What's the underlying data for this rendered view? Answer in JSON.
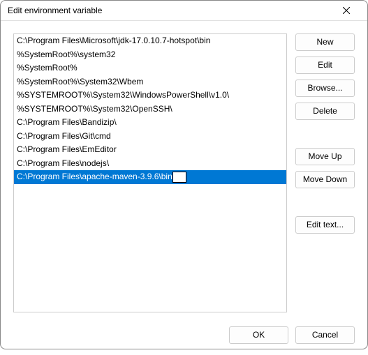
{
  "window": {
    "title": "Edit environment variable"
  },
  "list": {
    "items": [
      "C:\\Program Files\\Microsoft\\jdk-17.0.10.7-hotspot\\bin",
      "%SystemRoot%\\system32",
      "%SystemRoot%",
      "%SystemRoot%\\System32\\Wbem",
      "%SYSTEMROOT%\\System32\\WindowsPowerShell\\v1.0\\",
      "%SYSTEMROOT%\\System32\\OpenSSH\\",
      "C:\\Program Files\\Bandizip\\",
      "C:\\Program Files\\Git\\cmd",
      "C:\\Program Files\\EmEditor",
      "C:\\Program Files\\nodejs\\",
      "C:\\Program Files\\apache-maven-3.9.6\\bin"
    ],
    "selectedIndex": 10,
    "editing": true
  },
  "buttons": {
    "new": "New",
    "edit": "Edit",
    "browse": "Browse...",
    "delete": "Delete",
    "moveUp": "Move Up",
    "moveDown": "Move Down",
    "editText": "Edit text...",
    "ok": "OK",
    "cancel": "Cancel"
  }
}
